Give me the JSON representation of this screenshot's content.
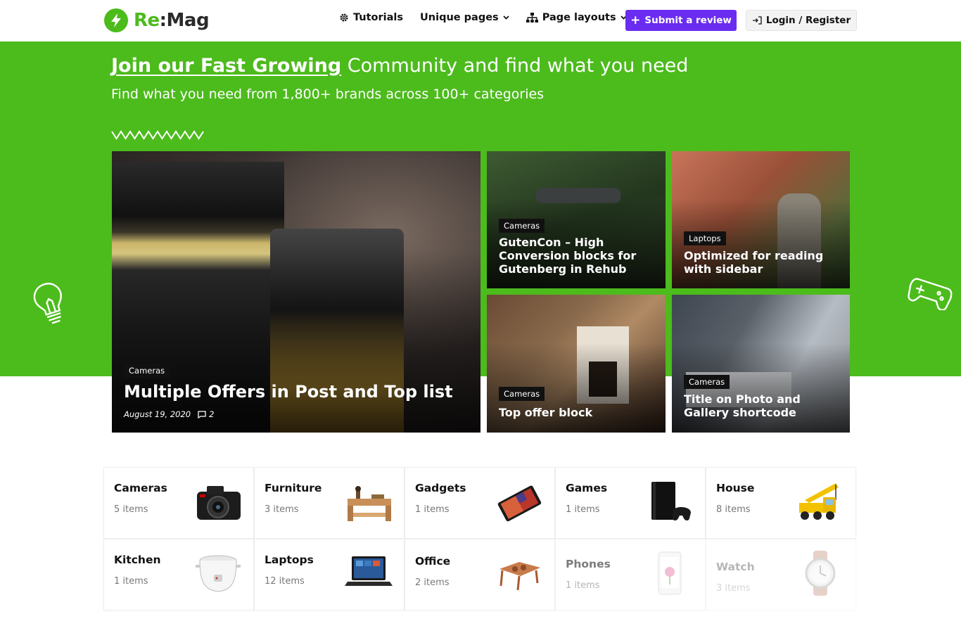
{
  "header": {
    "logo_re": "Re",
    "logo_mag": ":Mag",
    "nav": [
      {
        "label": "Tutorials",
        "icon": "gear-icon"
      },
      {
        "label": "Unique pages",
        "icon": "chevron-down-icon"
      },
      {
        "label": "Page layouts",
        "icon": "sitemap-icon"
      }
    ],
    "submit_label": "Submit a review",
    "login_label": "Login / Register"
  },
  "hero": {
    "title_highlight": "Join our Fast Growing",
    "title_rest": " Community and find what you need",
    "subtitle": "Find what you need from 1,800+ brands across 100+ categories",
    "accent_color": "#4cbb1c"
  },
  "posts": [
    {
      "category": "Cameras",
      "title": "Multiple Offers in Post and Top list",
      "date": "August 19, 2020",
      "comments": "2"
    },
    {
      "category": "Cameras",
      "title": "GutenCon – High Conversion blocks for Gutenberg in Rehub"
    },
    {
      "category": "Laptops",
      "title": "Optimized for reading with sidebar"
    },
    {
      "category": "Cameras",
      "title": "Top offer block"
    },
    {
      "category": "Cameras",
      "title": "Title on Photo and Gallery shortcode"
    }
  ],
  "categories": [
    {
      "name": "Cameras",
      "count": "5 items",
      "icon": "camera-icon"
    },
    {
      "name": "Furniture",
      "count": "3 items",
      "icon": "furniture-icon"
    },
    {
      "name": "Gadgets",
      "count": "1 items",
      "icon": "tablet-icon"
    },
    {
      "name": "Games",
      "count": "1 items",
      "icon": "game-console-icon"
    },
    {
      "name": "House",
      "count": "8 items",
      "icon": "crane-truck-icon"
    },
    {
      "name": "Kitchen",
      "count": "1 items",
      "icon": "rice-cooker-icon"
    },
    {
      "name": "Laptops",
      "count": "12 items",
      "icon": "laptop-icon"
    },
    {
      "name": "Office",
      "count": "2 items",
      "icon": "laptop-table-icon"
    },
    {
      "name": "Phones",
      "count": "1 items",
      "icon": "phone-icon"
    },
    {
      "name": "Watch",
      "count": "3 items",
      "icon": "watch-icon"
    }
  ]
}
